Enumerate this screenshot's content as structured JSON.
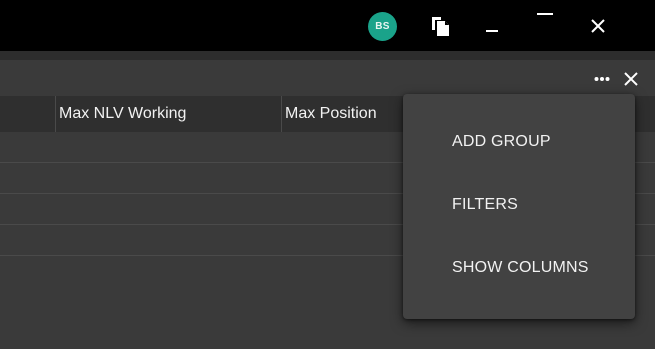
{
  "titlebar": {
    "avatar_initials": "BS",
    "avatar_color": "#1aa38a",
    "icons": [
      "copy-icon",
      "minimize-icon",
      "minimize-icon",
      "close-icon"
    ]
  },
  "panel": {
    "toolbar_icons": [
      "more-horizontal-icon",
      "close-icon"
    ],
    "columns": [
      {
        "label": "Max NLV Working"
      },
      {
        "label": "Max Position"
      }
    ],
    "rows": [
      {},
      {},
      {},
      {}
    ]
  },
  "menu": {
    "items": [
      {
        "label": "ADD GROUP"
      },
      {
        "label": "FILTERS"
      },
      {
        "label": "SHOW COLUMNS"
      }
    ]
  }
}
